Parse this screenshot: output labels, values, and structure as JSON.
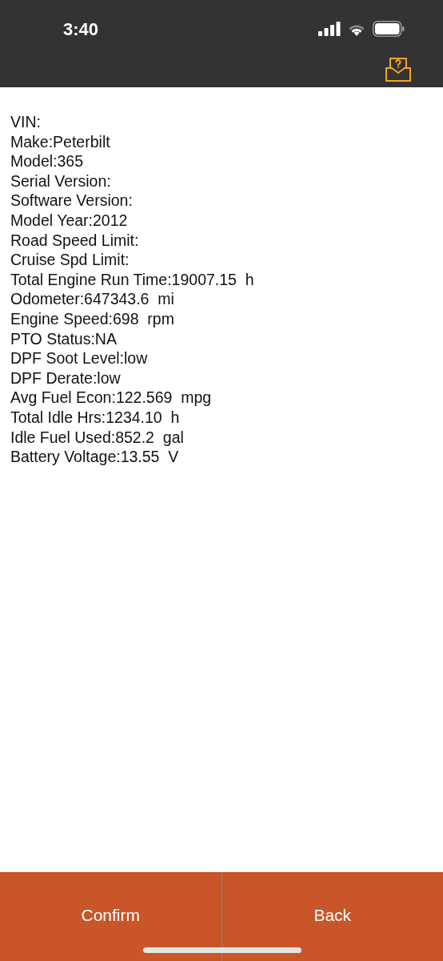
{
  "status_bar": {
    "time": "3:40"
  },
  "lines": [
    "VIN:",
    "Make:Peterbilt",
    "Model:365",
    "Serial Version:",
    "Software Version:",
    "Model Year:2012",
    "Road Speed Limit:",
    "Cruise Spd Limit:",
    "Total Engine Run Time:19007.15  h",
    "Odometer:647343.6  mi",
    "Engine Speed:698  rpm",
    "PTO Status:NA",
    "DPF Soot Level:low",
    "DPF Derate:low",
    "Avg Fuel Econ:122.569  mpg",
    "Total Idle Hrs:1234.10  h",
    "Idle Fuel Used:852.2  gal",
    "Battery Voltage:13.55  V"
  ],
  "buttons": [
    "Confirm",
    "Back"
  ]
}
